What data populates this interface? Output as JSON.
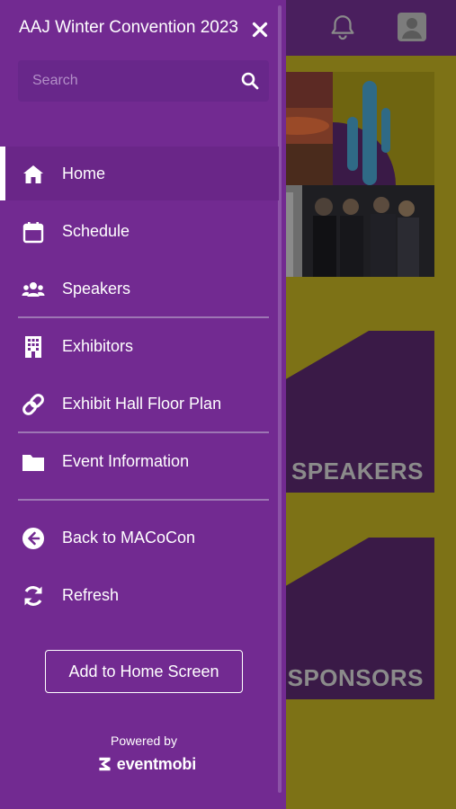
{
  "header": {
    "notification_icon": "bell-icon",
    "profile_icon": "user-avatar-icon"
  },
  "tiles": [
    {
      "id": "hero",
      "label": ""
    },
    {
      "id": "speakers",
      "label": "SPEAKERS"
    },
    {
      "id": "sponsors",
      "label": "SPONSORS"
    }
  ],
  "drawer": {
    "title": "AAJ Winter Convention 2023",
    "close_icon": "close-icon",
    "search": {
      "placeholder": "Search",
      "value": "",
      "icon": "search-icon"
    },
    "nav_items": [
      {
        "label": "Home",
        "icon": "home-icon",
        "active": true
      },
      {
        "label": "Schedule",
        "icon": "calendar-icon",
        "active": false
      },
      {
        "label": "Speakers",
        "icon": "users-icon",
        "active": false
      },
      {
        "label": "Exhibitors",
        "icon": "building-icon",
        "active": false
      },
      {
        "label": "Exhibit Hall Floor Plan",
        "icon": "link-icon",
        "active": false
      },
      {
        "label": "Event Information",
        "icon": "folder-icon",
        "active": false
      },
      {
        "label": "Back to MACoCon",
        "icon": "arrow-circle-left-icon",
        "active": false
      },
      {
        "label": "Refresh",
        "icon": "refresh-icon",
        "active": false
      }
    ],
    "add_home_button": "Add to Home Screen",
    "powered_by": "Powered by",
    "brand": "eventmobi"
  },
  "colors": {
    "drawer_bg": "#722a91",
    "active_item_bg": "#6a2688",
    "header_bg": "#4a1f5e",
    "backdrop": "#7d7216"
  }
}
